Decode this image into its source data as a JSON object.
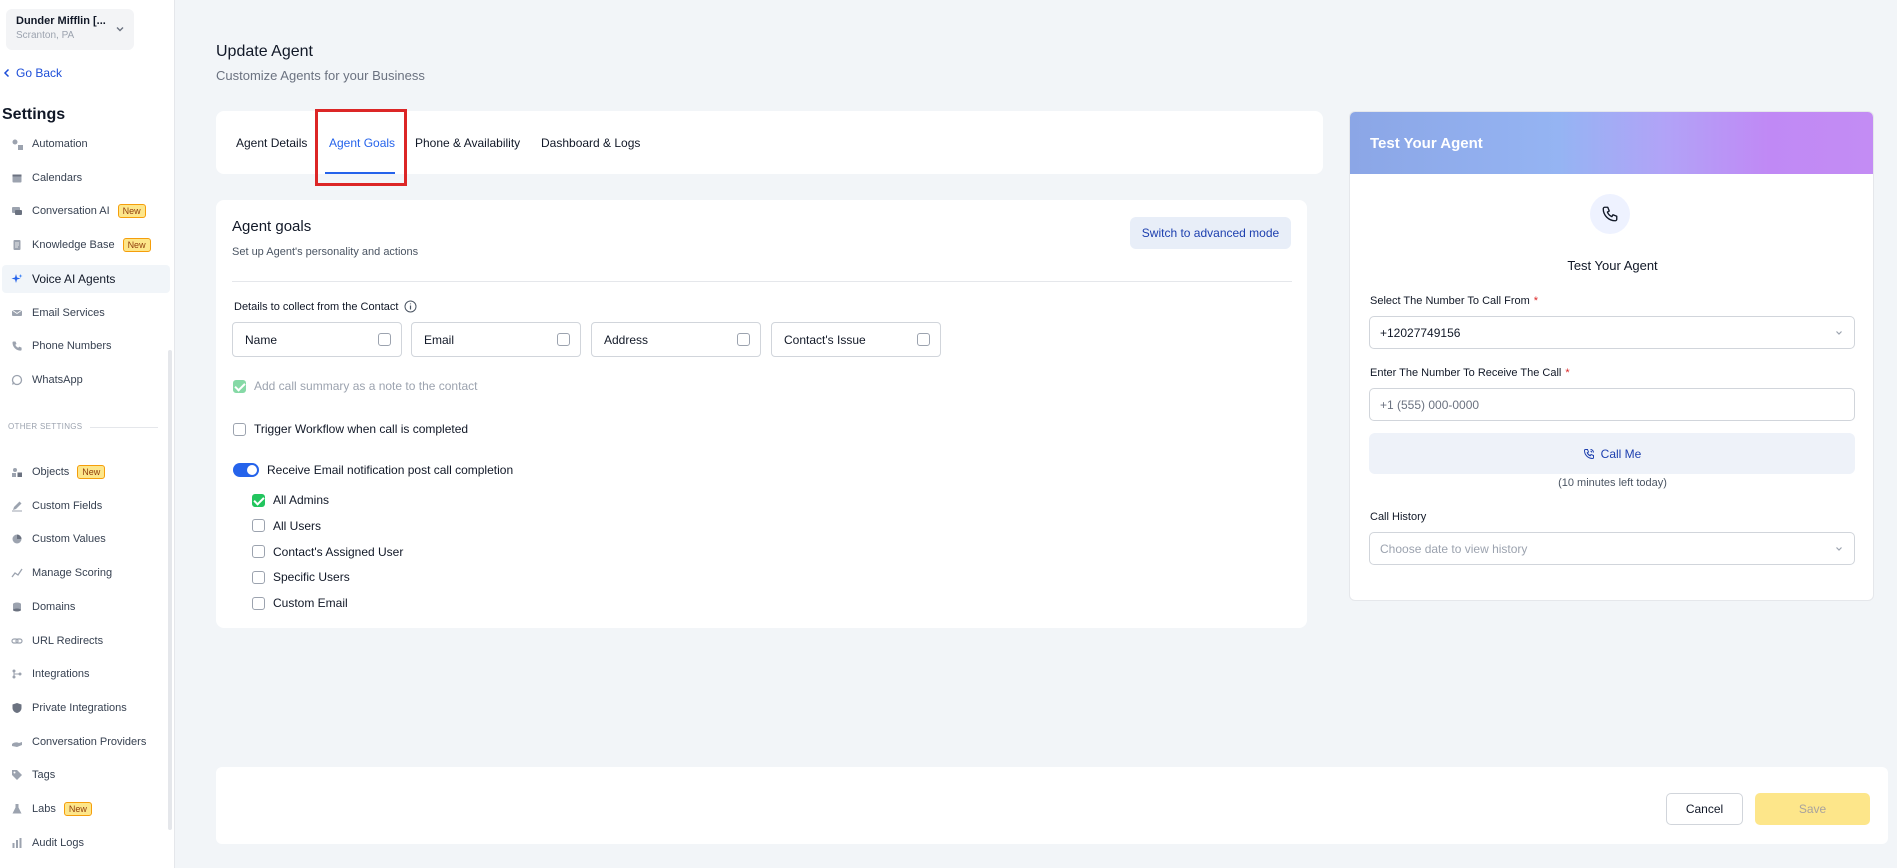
{
  "location": {
    "name": "Dunder Mifflin [...",
    "city": "Scranton, PA"
  },
  "sidebar": {
    "go_back": "Go Back",
    "title": "Settings",
    "badge": "New",
    "other_settings": "OTHER SETTINGS",
    "items": [
      {
        "label": "Automation",
        "icon": "automation-icon"
      },
      {
        "label": "Calendars",
        "icon": "calendar-icon"
      },
      {
        "label": "Conversation AI",
        "icon": "chat-icon",
        "badge": "New"
      },
      {
        "label": "Knowledge Base",
        "icon": "document-icon",
        "badge": "New"
      },
      {
        "label": "Voice AI Agents",
        "icon": "sparkle-icon",
        "active": true
      },
      {
        "label": "Email Services",
        "icon": "email-icon"
      },
      {
        "label": "Phone Numbers",
        "icon": "phone-icon"
      },
      {
        "label": "WhatsApp",
        "icon": "whatsapp-icon"
      }
    ],
    "other_items": [
      {
        "label": "Objects",
        "icon": "objects-icon",
        "badge": "New"
      },
      {
        "label": "Custom Fields",
        "icon": "pencil-icon"
      },
      {
        "label": "Custom Values",
        "icon": "pie-icon"
      },
      {
        "label": "Manage Scoring",
        "icon": "chart-icon"
      },
      {
        "label": "Domains",
        "icon": "database-icon"
      },
      {
        "label": "URL Redirects",
        "icon": "link-icon"
      },
      {
        "label": "Integrations",
        "icon": "integrations-icon"
      },
      {
        "label": "Private Integrations",
        "icon": "shield-icon"
      },
      {
        "label": "Conversation Providers",
        "icon": "hand-icon"
      },
      {
        "label": "Tags",
        "icon": "tag-icon"
      },
      {
        "label": "Labs",
        "icon": "flask-icon",
        "badge": "New"
      },
      {
        "label": "Audit Logs",
        "icon": "bar-chart-icon"
      }
    ]
  },
  "header": {
    "title": "Update Agent",
    "subtitle": "Customize Agents for your Business"
  },
  "tabs": [
    "Agent Details",
    "Agent Goals",
    "Phone & Availability",
    "Dashboard & Logs"
  ],
  "active_tab": "Agent Goals",
  "goals": {
    "title": "Agent goals",
    "subtitle": "Set up Agent's personality and actions",
    "advanced_button": "Switch to advanced mode",
    "details_label": "Details to collect from the Contact",
    "fields": [
      "Name",
      "Email",
      "Address",
      "Contact's Issue"
    ],
    "call_summary": "Add call summary as a note to the contact",
    "trigger_workflow": "Trigger Workflow when call is completed",
    "email_notification": "Receive Email notification post call completion",
    "recipients": [
      {
        "label": "All Admins",
        "checked": true
      },
      {
        "label": "All Users",
        "checked": false
      },
      {
        "label": "Contact's Assigned User",
        "checked": false
      },
      {
        "label": "Specific Users",
        "checked": false
      },
      {
        "label": "Custom Email",
        "checked": false
      }
    ]
  },
  "test": {
    "header": "Test Your Agent",
    "subtitle": "Test Your Agent",
    "from_label": "Select The Number To Call From",
    "from_value": "+12027749156",
    "to_label": "Enter The Number To Receive The Call",
    "to_placeholder": "+1 (555) 000-0000",
    "call_button": "Call Me",
    "minutes_left": "(10 minutes left today)",
    "history_label": "Call History",
    "history_placeholder": "Choose date to view history",
    "required_mark": "*"
  },
  "footer": {
    "cancel": "Cancel",
    "save": "Save"
  },
  "colors": {
    "primary": "#2563eb",
    "highlight": "#dc2626",
    "check": "#22c55e",
    "save": "#fde68a"
  }
}
